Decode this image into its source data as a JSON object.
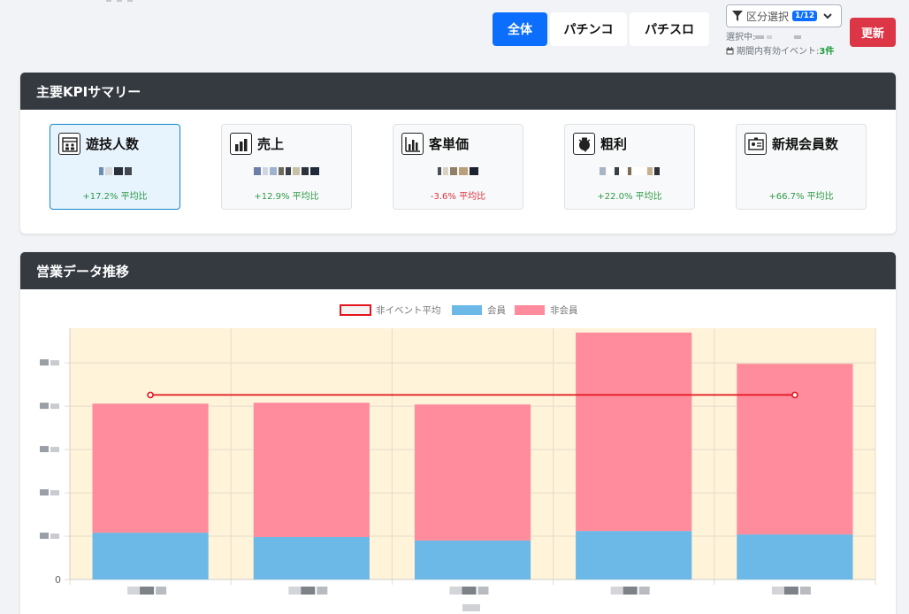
{
  "toolbar": {
    "segments": [
      {
        "label": "全体",
        "active": true
      },
      {
        "label": "パチンコ",
        "active": false
      },
      {
        "label": "パチスロ",
        "active": false
      }
    ],
    "filter": {
      "label": "区分選択",
      "badge": "1/12",
      "selected_prefix": "選択中:",
      "events_label": "期間内有効イベント:",
      "events_count": "3件"
    },
    "refresh_label": "更新"
  },
  "kpi": {
    "title": "主要KPIサマリー",
    "items": [
      {
        "label": "遊技人数",
        "icon": "calendar-people-icon",
        "change": "+17.2% 平均比",
        "trend": "up",
        "selected": true
      },
      {
        "label": "売上",
        "icon": "bar-columns-icon",
        "change": "+12.9% 平均比",
        "trend": "up",
        "selected": false
      },
      {
        "label": "客単価",
        "icon": "bar-chart-icon",
        "change": "-3.6% 平均比",
        "trend": "down",
        "selected": false
      },
      {
        "label": "粗利",
        "icon": "moneybag-icon",
        "change": "+22.0% 平均比",
        "trend": "up",
        "selected": false
      },
      {
        "label": "新規会員数",
        "icon": "id-card-icon",
        "change": "+66.7% 平均比",
        "trend": "up",
        "selected": false
      }
    ]
  },
  "chart": {
    "title": "営業データ推移"
  },
  "chart_data": {
    "type": "bar",
    "stacked": true,
    "legend_position": "top",
    "grid": true,
    "categories": [
      "",
      "",
      "",
      "",
      ""
    ],
    "series": [
      {
        "name": "会員",
        "color": "#6cb8e6",
        "values": [
          54,
          49,
          45,
          56,
          52
        ]
      },
      {
        "name": "非会員",
        "color": "#ff8c9c",
        "values": [
          149,
          155,
          157,
          229,
          197
        ]
      },
      {
        "name": "非イベント平均",
        "type": "line",
        "color": "#e5141d",
        "values": [
          213,
          213,
          213,
          213,
          213
        ]
      }
    ],
    "ylim": [
      0,
      290
    ],
    "yticks": [
      0,
      50,
      100,
      150,
      200,
      250
    ],
    "xlabel": "",
    "ylabel": "",
    "plot_background": "#fff3da"
  }
}
